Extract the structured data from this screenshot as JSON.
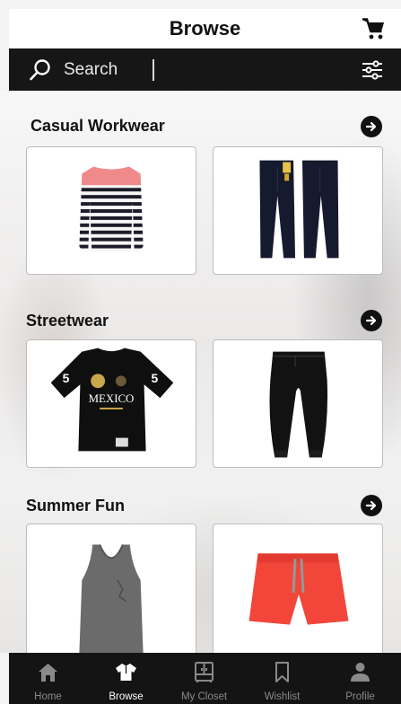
{
  "header": {
    "title": "Browse",
    "cart_icon": "shopping-cart-icon"
  },
  "search": {
    "label": "Search",
    "icon": "search-icon",
    "filter_icon": "filter-sliders-icon"
  },
  "sections": [
    {
      "title": "Casual Workwear",
      "items": [
        "striped-sweater",
        "dark-jeans"
      ]
    },
    {
      "title": "Streetwear",
      "items": [
        "mexico-tshirt",
        "black-joggers"
      ]
    },
    {
      "title": "Summer Fun",
      "items": [
        "grey-tank-top",
        "red-swim-shorts"
      ]
    }
  ],
  "product_text": {
    "shirt_print": "MEXICO"
  },
  "nav": {
    "items": [
      {
        "label": "Home",
        "icon": "home-icon",
        "active": false
      },
      {
        "label": "Browse",
        "icon": "shirt-icon",
        "active": true
      },
      {
        "label": "My Closet",
        "icon": "closet-icon",
        "active": false
      },
      {
        "label": "Wishlist",
        "icon": "bookmark-icon",
        "active": false
      },
      {
        "label": "Profile",
        "icon": "person-icon",
        "active": false
      }
    ]
  },
  "colors": {
    "bar": "#161616",
    "nav": "#141414",
    "accent": "#111111"
  }
}
